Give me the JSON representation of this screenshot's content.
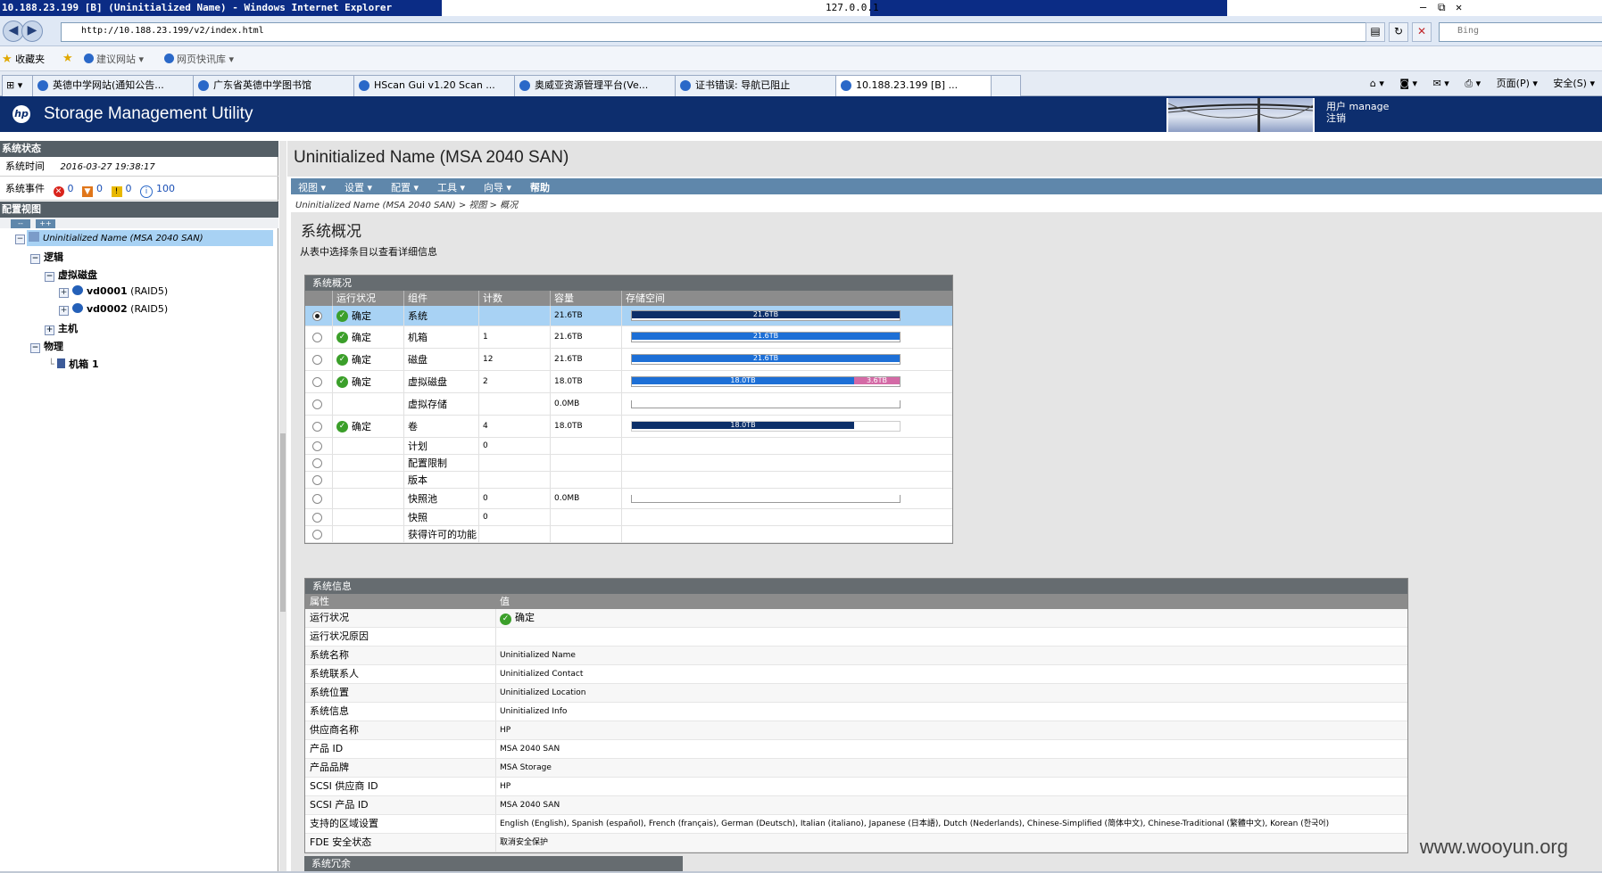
{
  "window": {
    "title": "10.188.23.199 [B] (Uninitialized Name) - Windows Internet Explorer",
    "center_text": "127.0.0.1",
    "controls": [
      "–",
      "⧉",
      "✕"
    ]
  },
  "address": {
    "url": "http://10.188.23.199/v2/index.html",
    "search_placeholder": "Bing"
  },
  "favorites": {
    "label": "收藏夹",
    "items": [
      "建议网站 ▾",
      "网页快讯库 ▾"
    ]
  },
  "tabs": [
    {
      "label": "英德中学网站(通知公告..."
    },
    {
      "label": "广东省英德中学图书馆"
    },
    {
      "label": "HScan Gui v1.20 Scan ..."
    },
    {
      "label": "奥威亚资源管理平台(Ve..."
    },
    {
      "label": "证书错误: 导航已阻止"
    },
    {
      "label": "10.188.23.199 [B] ...",
      "active": true
    }
  ],
  "commands": [
    "页面(P) ▾",
    "安全(S) ▾"
  ],
  "app": {
    "title": "Storage Management Utility",
    "logo": "hp",
    "user_label": "用户",
    "user_name": "manage",
    "logout": "注销"
  },
  "left": {
    "status_head": "系统状态",
    "time_label": "系统时间",
    "time_value": "2016-03-27 19:38:17",
    "events_label": "系统事件",
    "events": [
      {
        "icon": "critical-icon",
        "value": "0",
        "color": "#d9241c"
      },
      {
        "icon": "error-icon",
        "value": "0",
        "color": "#e0761a"
      },
      {
        "icon": "warning-icon",
        "value": "0",
        "color": "#e8b800"
      },
      {
        "icon": "info-icon",
        "value": "100",
        "color": "#2a68c8"
      }
    ],
    "config_head": "配置视图",
    "collapse_btn": "--",
    "expand_btn": "++",
    "tree": {
      "root": "Uninitialized Name (MSA 2040 SAN)",
      "logical": "逻辑",
      "vdisks": "虚拟磁盘",
      "vd1": "vd0001",
      "vd1_raid": "(RAID5)",
      "vd2": "vd0002",
      "vd2_raid": "(RAID5)",
      "hosts": "主机",
      "physical": "物理",
      "enclosure": "机箱 1"
    }
  },
  "main": {
    "title": "Uninitialized Name (MSA 2040 SAN)",
    "menu": [
      "视图 ▾",
      "设置 ▾",
      "配置 ▾",
      "工具 ▾",
      "向导 ▾",
      "帮助"
    ],
    "breadcrumb": "Uninitialized Name (MSA 2040 SAN) > 视图 > 概况",
    "section_title": "系统概况",
    "section_sub": "从表中选择条目以查看详细信息",
    "overview": {
      "group": "系统概况",
      "headers": [
        "运行状况",
        "组件",
        "计数",
        "容量",
        "存储空间"
      ],
      "rows": [
        {
          "health": "确定",
          "component": "系统",
          "count": "",
          "capacity": "21.6TB",
          "bar": [
            {
              "label": "21.6TB",
              "frac": 1.0,
              "color": "#0c2f69"
            }
          ],
          "selected": true
        },
        {
          "health": "确定",
          "component": "机箱",
          "count": "1",
          "capacity": "21.6TB",
          "bar": [
            {
              "label": "21.6TB",
              "frac": 1.0,
              "color": "#1d6fd6"
            }
          ]
        },
        {
          "health": "确定",
          "component": "磁盘",
          "count": "12",
          "capacity": "21.6TB",
          "bar": [
            {
              "label": "21.6TB",
              "frac": 1.0,
              "color": "#1d6fd6"
            }
          ]
        },
        {
          "health": "确定",
          "component": "虚拟磁盘",
          "count": "2",
          "capacity": "18.0TB",
          "bar": [
            {
              "label": "18.0TB",
              "frac": 0.83,
              "color": "#1d6fd6"
            },
            {
              "label": "3.6TB",
              "frac": 0.17,
              "color": "#d46aa6"
            }
          ]
        },
        {
          "health": "",
          "component": "虚拟存储",
          "count": "",
          "capacity": "0.0MB",
          "bar": [],
          "empty_bar": true
        },
        {
          "health": "确定",
          "component": "卷",
          "count": "4",
          "capacity": "18.0TB",
          "bar": [
            {
              "label": "18.0TB",
              "frac": 0.83,
              "color": "#0c2f69"
            }
          ]
        },
        {
          "health": "",
          "component": "计划",
          "count": "0",
          "capacity": "",
          "bar": []
        },
        {
          "health": "",
          "component": "配置限制",
          "count": "",
          "capacity": "",
          "bar": []
        },
        {
          "health": "",
          "component": "版本",
          "count": "",
          "capacity": "",
          "bar": []
        },
        {
          "health": "",
          "component": "快照池",
          "count": "0",
          "capacity": "0.0MB",
          "bar": [],
          "empty_bar": true
        },
        {
          "health": "",
          "component": "快照",
          "count": "0",
          "capacity": "",
          "bar": []
        },
        {
          "health": "",
          "component": "获得许可的功能",
          "count": "",
          "capacity": "",
          "bar": []
        }
      ]
    },
    "info": {
      "group": "系统信息",
      "headers": [
        "属性",
        "值"
      ],
      "rows": [
        {
          "prop": "运行状况",
          "val": "确定",
          "ok": true
        },
        {
          "prop": "运行状况原因",
          "val": ""
        },
        {
          "prop": "系统名称",
          "val": "Uninitialized Name"
        },
        {
          "prop": "系统联系人",
          "val": "Uninitialized Contact"
        },
        {
          "prop": "系统位置",
          "val": "Uninitialized Location"
        },
        {
          "prop": "系统信息",
          "val": "Uninitialized Info"
        },
        {
          "prop": "供应商名称",
          "val": "HP"
        },
        {
          "prop": "产品 ID",
          "val": "MSA 2040 SAN"
        },
        {
          "prop": "产品品牌",
          "val": "MSA Storage"
        },
        {
          "prop": "SCSI 供应商 ID",
          "val": "HP"
        },
        {
          "prop": "SCSI 产品 ID",
          "val": "MSA 2040 SAN"
        },
        {
          "prop": "支持的区域设置",
          "val": "English (English), Spanish (español), French (français), German (Deutsch), Italian (italiano), Japanese (日本語), Dutch (Nederlands), Chinese-Simplified (简体中文), Chinese-Traditional (繁體中文), Korean (한국어)"
        },
        {
          "prop": "FDE 安全状态",
          "val": "取消安全保护"
        }
      ]
    },
    "redundancy_group": "系统冗余"
  },
  "watermark": "www.wooyun.org"
}
